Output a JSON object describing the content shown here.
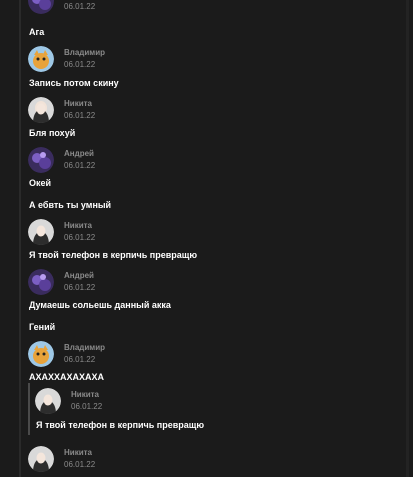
{
  "messages": [
    {
      "author": "",
      "time": "06.01.22",
      "text": "Ага",
      "avatar": "andrey-avatar"
    },
    {
      "author": "Владимир",
      "time": "06.01.22",
      "text": "Запись потом скину",
      "avatar": "vladimir-avatar"
    },
    {
      "author": "Никита",
      "time": "06.01.22",
      "text": "Бля похуй",
      "avatar": "nikita-avatar"
    },
    {
      "author": "Андрей",
      "time": "06.01.22",
      "text": "Окей",
      "text2": "А ебвть ты умный",
      "avatar": "andrey-avatar"
    },
    {
      "author": "Никита",
      "time": "06.01.22",
      "text": "Я твой телефон в керпичь превращю",
      "avatar": "nikita-avatar"
    },
    {
      "author": "Андрей",
      "time": "06.01.22",
      "text": "Думаешь сольешь данный акка",
      "text2": "Гений",
      "avatar": "andrey-avatar"
    },
    {
      "author": "Владимир",
      "time": "06.01.22",
      "text": "АХАХХАХАХАХА",
      "avatar": "vladimir-avatar"
    },
    {
      "author": "Никита",
      "time": "06.01.22",
      "text": "",
      "avatar": "nikita-avatar"
    }
  ],
  "quote": {
    "author": "Никита",
    "time": "06.01.22",
    "text": "Я твой телефон в керпичь превращю"
  }
}
